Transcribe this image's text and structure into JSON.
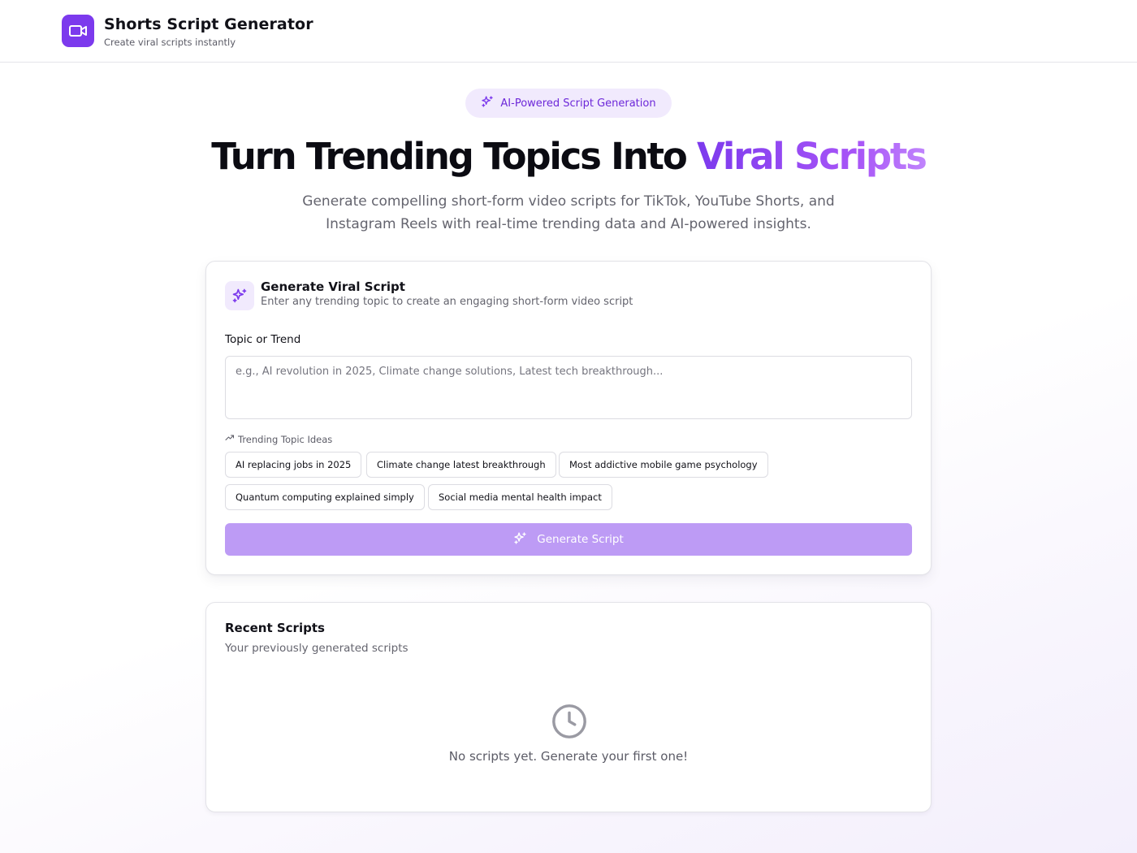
{
  "header": {
    "app_title": "Shorts Script Generator",
    "app_subtitle": "Create viral scripts instantly",
    "logo_icon": "video-camera-icon"
  },
  "hero": {
    "badge": "AI-Powered Script Generation",
    "badge_icon": "sparkles-icon",
    "title_part1": "Turn Trending Topics Into",
    "title_highlight": "Viral Scripts",
    "description": "Generate compelling short-form video scripts for TikTok, YouTube Shorts, and Instagram Reels with real-time trending data and AI-powered insights."
  },
  "generator": {
    "title": "Generate Viral Script",
    "subtitle": "Enter any trending topic to create an engaging short-form video script",
    "icon": "sparkles-icon",
    "input_label": "Topic or Trend",
    "input_value": "",
    "input_placeholder": "e.g., AI revolution in 2025, Climate change solutions, Latest tech breakthrough...",
    "trending_label": "Trending Topic Ideas",
    "trending_icon": "trending-up-icon",
    "chips": [
      "AI replacing jobs in 2025",
      "Climate change latest breakthrough",
      "Most addictive mobile game psychology",
      "Quantum computing explained simply",
      "Social media mental health impact"
    ],
    "button_label": "Generate Script",
    "button_icon": "sparkles-icon"
  },
  "recent": {
    "title": "Recent Scripts",
    "subtitle": "Your previously generated scripts",
    "empty_icon": "clock-icon",
    "empty_text": "No scripts yet. Generate your first one!"
  },
  "colors": {
    "brand": "#7c3aed",
    "badge_bg": "#f1eafd",
    "button_disabled": "#bd9bf5"
  }
}
